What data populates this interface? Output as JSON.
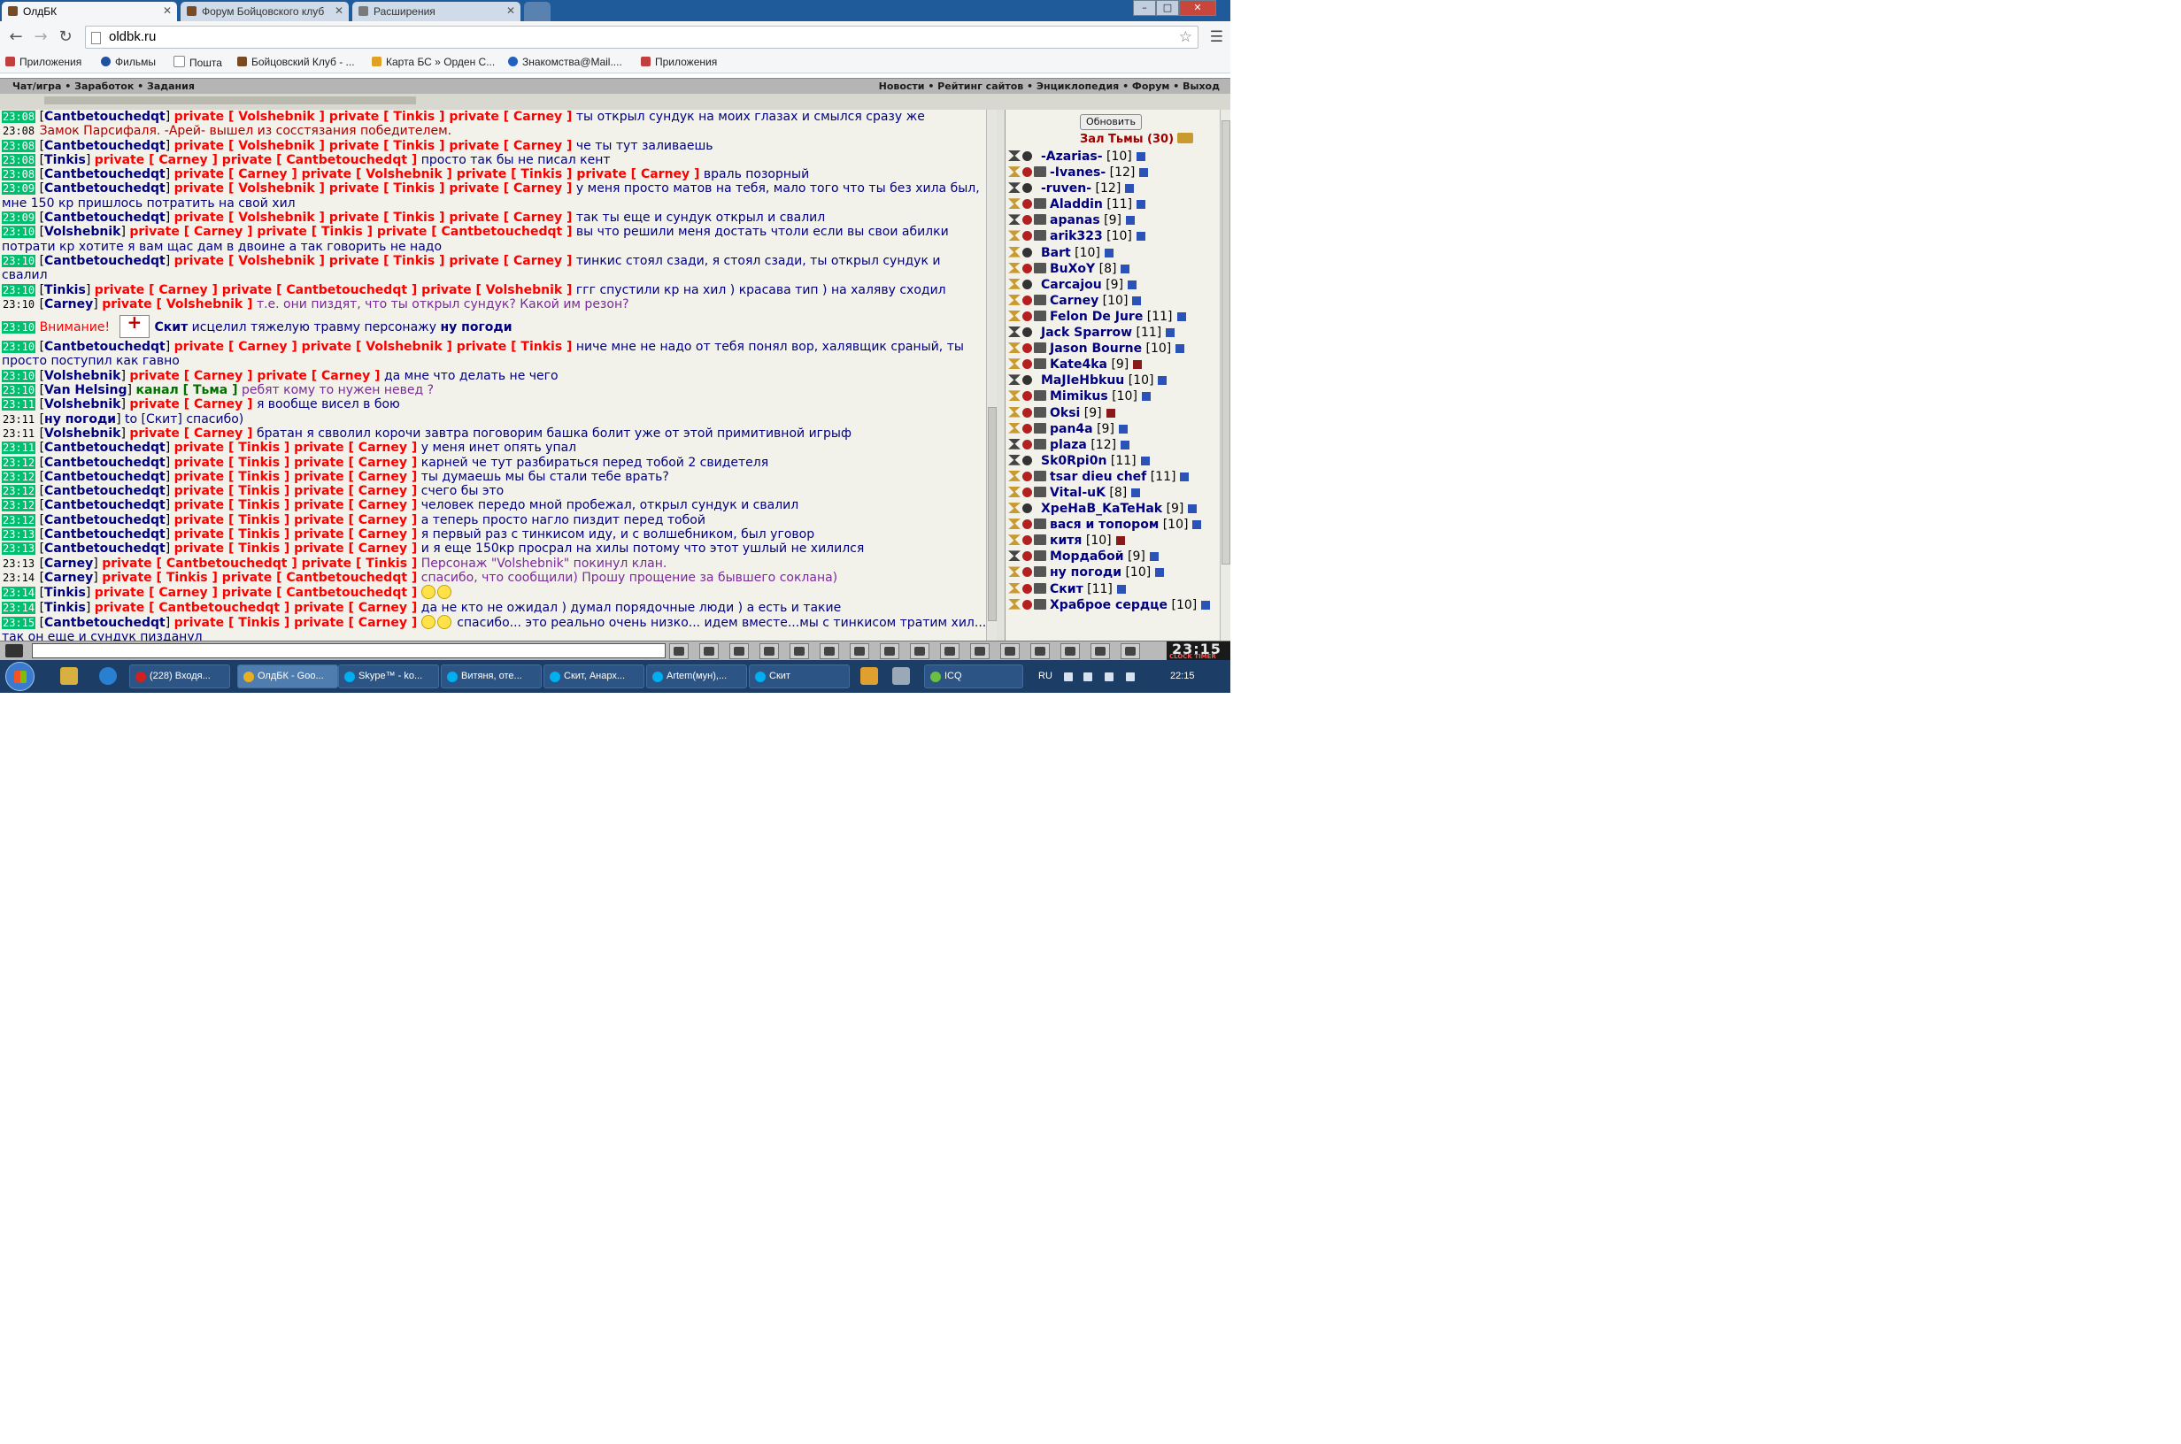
{
  "browser": {
    "tabs": [
      {
        "label": "ОлдБК",
        "active": true
      },
      {
        "label": "Форум Бойцовского клуб",
        "active": false
      },
      {
        "label": "Расширения",
        "active": false
      }
    ],
    "url": "oldbk.ru",
    "bookmarks": [
      {
        "label": "Приложения",
        "icon": "apps-icon"
      },
      {
        "label": "Фильмы",
        "icon": "film-icon"
      },
      {
        "label": "Пошта",
        "icon": "page-icon"
      },
      {
        "label": "Бойцовский Клуб - ...",
        "icon": "oldbk-icon"
      },
      {
        "label": "Карта БС » Орден С...",
        "icon": "map-icon"
      },
      {
        "label": "Знакомства@Mail....",
        "icon": "mail-icon"
      },
      {
        "label": "Приложения",
        "icon": "apps-icon"
      }
    ]
  },
  "game_nav": {
    "left": "Чат/игра • Заработок • Задания",
    "right": "Новости • Рейтинг сайтов • Энциклопедия • Форум • Выход"
  },
  "chat": [
    {
      "time": "23:08",
      "hl": true,
      "parts": [
        [
          "nick",
          "Cantbetouchedqt"
        ],
        [
          "priv",
          "private [ Volshebnik ] private [ Tinkis ] private [ Carney ]"
        ],
        [
          "msg",
          "ты открыл сундук на моих глазах и смылся сразу же"
        ]
      ]
    },
    {
      "time": "23:08",
      "hl": false,
      "parts": [
        [
          "sys",
          "Замок Парсифаля. -Арей- вышел из сосстязания победителем."
        ]
      ]
    },
    {
      "time": "23:08",
      "hl": true,
      "parts": [
        [
          "nick",
          "Cantbetouchedqt"
        ],
        [
          "priv",
          "private [ Volshebnik ] private [ Tinkis ] private [ Carney ]"
        ],
        [
          "msg",
          "че ты тут заливаешь"
        ]
      ]
    },
    {
      "time": "23:08",
      "hl": true,
      "parts": [
        [
          "nick",
          "Tinkis"
        ],
        [
          "priv",
          "private [ Carney ] private [ Cantbetouchedqt ]"
        ],
        [
          "msg",
          "просто так бы не писал кент"
        ]
      ]
    },
    {
      "time": "23:08",
      "hl": true,
      "parts": [
        [
          "nick",
          "Cantbetouchedqt"
        ],
        [
          "priv",
          "private [ Carney ] private [ Volshebnik ] private [ Tinkis ] private [ Carney ]"
        ],
        [
          "msg",
          "враль позорный"
        ]
      ]
    },
    {
      "time": "23:09",
      "hl": true,
      "parts": [
        [
          "nick",
          "Cantbetouchedqt"
        ],
        [
          "priv",
          "private [ Volshebnik ] private [ Tinkis ] private [ Carney ]"
        ],
        [
          "msg",
          "у меня просто матов на тебя, мало того что ты без хила был, мне 150 кр пришлось потратить на свой хил"
        ]
      ]
    },
    {
      "time": "23:09",
      "hl": true,
      "parts": [
        [
          "nick",
          "Cantbetouchedqt"
        ],
        [
          "priv",
          "private [ Volshebnik ] private [ Tinkis ] private [ Carney ]"
        ],
        [
          "msg",
          "так ты еще и сундук открыл и свалил"
        ]
      ]
    },
    {
      "time": "23:10",
      "hl": true,
      "parts": [
        [
          "nick",
          "Volshebnik"
        ],
        [
          "priv",
          "private [ Carney ] private [ Tinkis ] private [ Cantbetouchedqt ]"
        ],
        [
          "msg",
          "вы что решили меня достать чтоли если вы свои абилки потрати кр хотите я вам щас дам в двоине а так говорить не надо"
        ]
      ]
    },
    {
      "time": "23:10",
      "hl": true,
      "parts": [
        [
          "nick",
          "Cantbetouchedqt"
        ],
        [
          "priv",
          "private [ Volshebnik ] private [ Tinkis ] private [ Carney ]"
        ],
        [
          "msg",
          "тинкис стоял сзади, я стоял сзади, ты открыл сундук и свалил"
        ]
      ]
    },
    {
      "time": "23:10",
      "hl": true,
      "parts": [
        [
          "nick",
          "Tinkis"
        ],
        [
          "priv",
          "private [ Carney ] private [ Cantbetouchedqt ] private [ Volshebnik ]"
        ],
        [
          "msg",
          "ггг спустили кр на хил ) красава тип ) на халяву сходил"
        ]
      ]
    },
    {
      "time": "23:10",
      "hl": false,
      "parts": [
        [
          "nick",
          "Carney"
        ],
        [
          "priv",
          "private [ Volshebnik ]"
        ],
        [
          "msg vi",
          "т.е. они пиздят, что ты открыл сундук? Какой им резон?"
        ]
      ]
    },
    {
      "time": "23:10",
      "hl": true,
      "heal": true,
      "parts": [
        [
          "warn",
          "Внимание!"
        ],
        [
          "heal",
          ""
        ],
        [
          "nick",
          "Скит"
        ],
        [
          "msg2",
          "исцелил тяжелую травму персонажу"
        ],
        [
          "nick2",
          "ну погоди"
        ]
      ]
    },
    {
      "time": "23:10",
      "hl": true,
      "parts": [
        [
          "nick",
          "Cantbetouchedqt"
        ],
        [
          "priv",
          "private [ Carney ] private [ Volshebnik ] private [ Tinkis ]"
        ],
        [
          "msg",
          "ниче мне не надо от тебя понял вор, халявщик сраный, ты просто поступил как гавно"
        ]
      ]
    },
    {
      "time": "23:10",
      "hl": true,
      "parts": [
        [
          "nick",
          "Volshebnik"
        ],
        [
          "priv",
          "private [ Carney ] private [ Carney ]"
        ],
        [
          "msg",
          "да мне что делать не чего"
        ]
      ]
    },
    {
      "time": "23:10",
      "hl": true,
      "parts": [
        [
          "nick",
          "Van Helsing"
        ],
        [
          "chan",
          "канал [ Тьма ]"
        ],
        [
          "msg vi",
          "ребят кому то нужен невед ?"
        ]
      ]
    },
    {
      "time": "23:11",
      "hl": true,
      "parts": [
        [
          "nick",
          "Volshebnik"
        ],
        [
          "priv",
          "private [ Carney ]"
        ],
        [
          "msg",
          "я вообще висел в бою"
        ]
      ]
    },
    {
      "time": "23:11",
      "hl": false,
      "parts": [
        [
          "nick",
          "ну погоди"
        ],
        [
          "msg",
          "to [Скит] спасибо)"
        ]
      ]
    },
    {
      "time": "23:11",
      "hl": false,
      "parts": [
        [
          "nick",
          "Volshebnik"
        ],
        [
          "priv",
          "private [ Carney ]"
        ],
        [
          "msg",
          "братан я свволил корочи завтра поговорим башка болит уже от этой примитивной игрыф"
        ]
      ]
    },
    {
      "time": "23:11",
      "hl": true,
      "parts": [
        [
          "nick",
          "Cantbetouchedqt"
        ],
        [
          "priv",
          "private [ Tinkis ] private [ Carney ]"
        ],
        [
          "msg",
          "у меня инет опять упал"
        ]
      ]
    },
    {
      "time": "23:12",
      "hl": true,
      "parts": [
        [
          "nick",
          "Cantbetouchedqt"
        ],
        [
          "priv",
          "private [ Tinkis ] private [ Carney ]"
        ],
        [
          "msg",
          "карней че тут разбираться перед тобой 2 свидетеля"
        ]
      ]
    },
    {
      "time": "23:12",
      "hl": true,
      "parts": [
        [
          "nick",
          "Cantbetouchedqt"
        ],
        [
          "priv",
          "private [ Tinkis ] private [ Carney ]"
        ],
        [
          "msg",
          "ты думаешь мы бы стали тебе врать?"
        ]
      ]
    },
    {
      "time": "23:12",
      "hl": true,
      "parts": [
        [
          "nick",
          "Cantbetouchedqt"
        ],
        [
          "priv",
          "private [ Tinkis ] private [ Carney ]"
        ],
        [
          "msg",
          "счего бы это"
        ]
      ]
    },
    {
      "time": "23:12",
      "hl": true,
      "parts": [
        [
          "nick",
          "Cantbetouchedqt"
        ],
        [
          "priv",
          "private [ Tinkis ] private [ Carney ]"
        ],
        [
          "msg",
          "человек передо мной пробежал, открыл сундук и свалил"
        ]
      ]
    },
    {
      "time": "23:12",
      "hl": true,
      "parts": [
        [
          "nick",
          "Cantbetouchedqt"
        ],
        [
          "priv",
          "private [ Tinkis ] private [ Carney ]"
        ],
        [
          "msg",
          "а теперь просто нагло пиздит перед тобой"
        ]
      ]
    },
    {
      "time": "23:13",
      "hl": true,
      "parts": [
        [
          "nick",
          "Cantbetouchedqt"
        ],
        [
          "priv",
          "private [ Tinkis ] private [ Carney ]"
        ],
        [
          "msg",
          "я первый раз с тинкисом иду, и с волшебником, был уговор"
        ]
      ]
    },
    {
      "time": "23:13",
      "hl": true,
      "parts": [
        [
          "nick",
          "Cantbetouchedqt"
        ],
        [
          "priv",
          "private [ Tinkis ] private [ Carney ]"
        ],
        [
          "msg",
          "и я еще 150кр просрал на хилы потому что этот ушлый не хилился"
        ]
      ]
    },
    {
      "time": "23:13",
      "hl": false,
      "parts": [
        [
          "nick",
          "Carney"
        ],
        [
          "priv",
          "private [ Cantbetouchedqt ] private [ Tinkis ]"
        ],
        [
          "msg vi",
          "Персонаж \"Volshebnik\" покинул клан."
        ]
      ]
    },
    {
      "time": "23:14",
      "hl": false,
      "parts": [
        [
          "nick",
          "Carney"
        ],
        [
          "priv",
          "private [ Tinkis ] private [ Cantbetouchedqt ]"
        ],
        [
          "msg vi",
          "спасибо, что сообщили) Прошу прощение за бывшего соклана)"
        ]
      ]
    },
    {
      "time": "23:14",
      "hl": true,
      "parts": [
        [
          "nick",
          "Tinkis"
        ],
        [
          "priv",
          "private [ Carney ] private [ Cantbetouchedqt ]"
        ],
        [
          "smiley",
          ""
        ]
      ]
    },
    {
      "time": "23:14",
      "hl": true,
      "parts": [
        [
          "nick",
          "Tinkis"
        ],
        [
          "priv",
          "private [ Cantbetouchedqt ] private [ Carney ]"
        ],
        [
          "msg",
          "да не кто не ожидал ) думал порядочные люди ) а есть и такие"
        ]
      ]
    },
    {
      "time": "23:15",
      "hl": true,
      "parts": [
        [
          "nick",
          "Cantbetouchedqt"
        ],
        [
          "priv",
          "private [ Tinkis ] private [ Carney ]"
        ],
        [
          "smiley",
          ""
        ],
        [
          "msg",
          "спасибо... это реально очень низко... идем вместе...мы с тинкисом тратим хил... так он еще и сундук пизданул"
        ]
      ]
    }
  ],
  "users": {
    "refresh_label": "Обновить",
    "room_title": "Зал Тьмы (30)",
    "list": [
      {
        "name": "-Azarias-",
        "level": "[10]",
        "w": "neu",
        "a": "k",
        "clan": false
      },
      {
        "name": "-Ivanes-",
        "level": "[12]",
        "w": "war",
        "a": "r",
        "clan": true
      },
      {
        "name": "-ruven-",
        "level": "[12]",
        "w": "neu",
        "a": "k",
        "clan": false
      },
      {
        "name": "Aladdin",
        "level": "[11]",
        "w": "war",
        "a": "r",
        "clan": true
      },
      {
        "name": "apanas",
        "level": "[9]",
        "w": "neu",
        "a": "r",
        "clan": true
      },
      {
        "name": "arik323",
        "level": "[10]",
        "w": "war",
        "a": "r",
        "clan": true
      },
      {
        "name": "Bart",
        "level": "[10]",
        "w": "war",
        "a": "k",
        "clan": false
      },
      {
        "name": "BuXoY",
        "level": "[8]",
        "w": "war",
        "a": "r",
        "clan": true
      },
      {
        "name": "Carcajou",
        "level": "[9]",
        "w": "war",
        "a": "k",
        "clan": false
      },
      {
        "name": "Carney",
        "level": "[10]",
        "w": "war",
        "a": "r",
        "clan": true
      },
      {
        "name": "Felon De Jure",
        "level": "[11]",
        "w": "war",
        "a": "r",
        "clan": true
      },
      {
        "name": "Jack Sparrow",
        "level": "[11]",
        "w": "neu",
        "a": "k",
        "clan": false
      },
      {
        "name": "Jason Bourne",
        "level": "[10]",
        "w": "war",
        "a": "r",
        "clan": true
      },
      {
        "name": "Kate4ka",
        "level": "[9]",
        "w": "war",
        "a": "r",
        "clan": true,
        "red": true
      },
      {
        "name": "MaJIeHbkuu",
        "level": "[10]",
        "w": "neu",
        "a": "k",
        "clan": false
      },
      {
        "name": "Mimikus",
        "level": "[10]",
        "w": "war",
        "a": "r",
        "clan": true
      },
      {
        "name": "Oksi",
        "level": "[9]",
        "w": "war",
        "a": "r",
        "clan": true,
        "red": true
      },
      {
        "name": "pan4a",
        "level": "[9]",
        "w": "war",
        "a": "r",
        "clan": true
      },
      {
        "name": "plaza",
        "level": "[12]",
        "w": "neu",
        "a": "r",
        "clan": true
      },
      {
        "name": "Sk0Rpi0n",
        "level": "[11]",
        "w": "neu",
        "a": "k",
        "clan": false
      },
      {
        "name": "tsar dieu chef",
        "level": "[11]",
        "w": "war",
        "a": "r",
        "clan": true
      },
      {
        "name": "Vital-uK",
        "level": "[8]",
        "w": "war",
        "a": "r",
        "clan": true
      },
      {
        "name": "XpeHaB_KaTeHak",
        "level": "[9]",
        "w": "war",
        "a": "k",
        "clan": false
      },
      {
        "name": "вася и топором",
        "level": "[10]",
        "w": "war",
        "a": "r",
        "clan": true
      },
      {
        "name": "китя",
        "level": "[10]",
        "w": "war",
        "a": "r",
        "clan": true,
        "red": true
      },
      {
        "name": "Мордабой",
        "level": "[9]",
        "w": "neu",
        "a": "r",
        "clan": true
      },
      {
        "name": "ну погоди",
        "level": "[10]",
        "w": "war",
        "a": "r",
        "clan": true
      },
      {
        "name": "Скит",
        "level": "[11]",
        "w": "war",
        "a": "r",
        "clan": true
      },
      {
        "name": "Храброе сердце",
        "level": "[10]",
        "w": "war",
        "a": "r",
        "clan": true
      }
    ]
  },
  "clock": {
    "time": "23:15",
    "sub": "CLOCK TIMER"
  },
  "taskbar": {
    "items": [
      {
        "label": "(228) Входя...",
        "color": "#d02020"
      },
      {
        "label": "ОлдБК - Goo...",
        "color": "#e8b020",
        "active": true
      },
      {
        "label": "Skype™ - ko...",
        "color": "#00aff0"
      },
      {
        "label": "Витяня, оте...",
        "color": "#00aff0"
      },
      {
        "label": "Скит, Анарх...",
        "color": "#00aff0"
      },
      {
        "label": "Artem(мун),...",
        "color": "#00aff0"
      },
      {
        "label": "Скит",
        "color": "#00aff0"
      },
      {
        "label": "ICQ",
        "color": "#6ac040"
      }
    ],
    "lang": "RU",
    "time": "22:15"
  }
}
